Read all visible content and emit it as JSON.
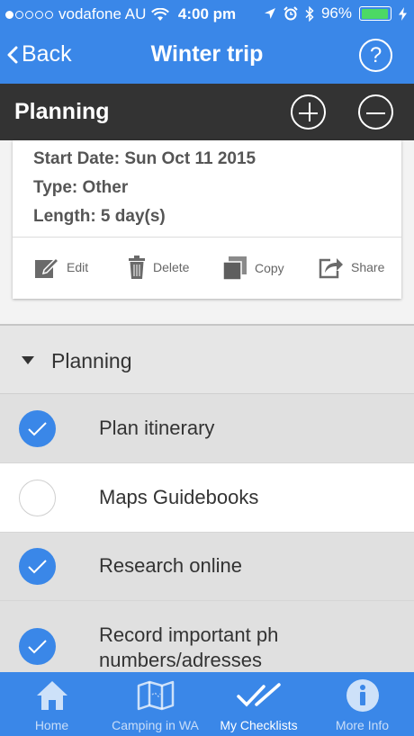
{
  "status_bar": {
    "carrier": "vodafone AU",
    "time": "4:00 pm",
    "battery": "96%",
    "battery_level": 0.96,
    "signal_bars": 1
  },
  "nav": {
    "back_label": "Back",
    "title": "Winter trip",
    "help_symbol": "?"
  },
  "section_header": {
    "title": "Planning"
  },
  "trip_card": {
    "start_date": "Start Date: Sun Oct 11 2015",
    "type": "Type: Other",
    "length": "Length: 5 day(s)",
    "actions": [
      {
        "label": "Edit",
        "icon": "edit-icon"
      },
      {
        "label": "Delete",
        "icon": "trash-icon"
      },
      {
        "label": "Copy",
        "icon": "copy-icon"
      },
      {
        "label": "Share",
        "icon": "share-icon"
      }
    ]
  },
  "category": {
    "label": "Planning",
    "expanded": true
  },
  "items": [
    {
      "label": "Plan itinerary",
      "checked": true
    },
    {
      "label": "Maps Guidebooks",
      "checked": false
    },
    {
      "label": "Research online",
      "checked": true
    },
    {
      "label_line1": "Record important ph",
      "label_line2": "numbers/adresses",
      "checked": true
    }
  ],
  "tabs": [
    {
      "label": "Home",
      "icon": "home-icon",
      "active": false
    },
    {
      "label": "Camping in WA",
      "icon": "map-icon",
      "active": false
    },
    {
      "label": "My Checklists",
      "icon": "double-check-icon",
      "active": true
    },
    {
      "label": "More Info",
      "icon": "info-icon",
      "active": false
    }
  ],
  "colors": {
    "accent_blue": "#3a87e8",
    "dark_bar": "#333333",
    "checked_row": "#e0e0e0",
    "battery_green": "#4cd964"
  }
}
